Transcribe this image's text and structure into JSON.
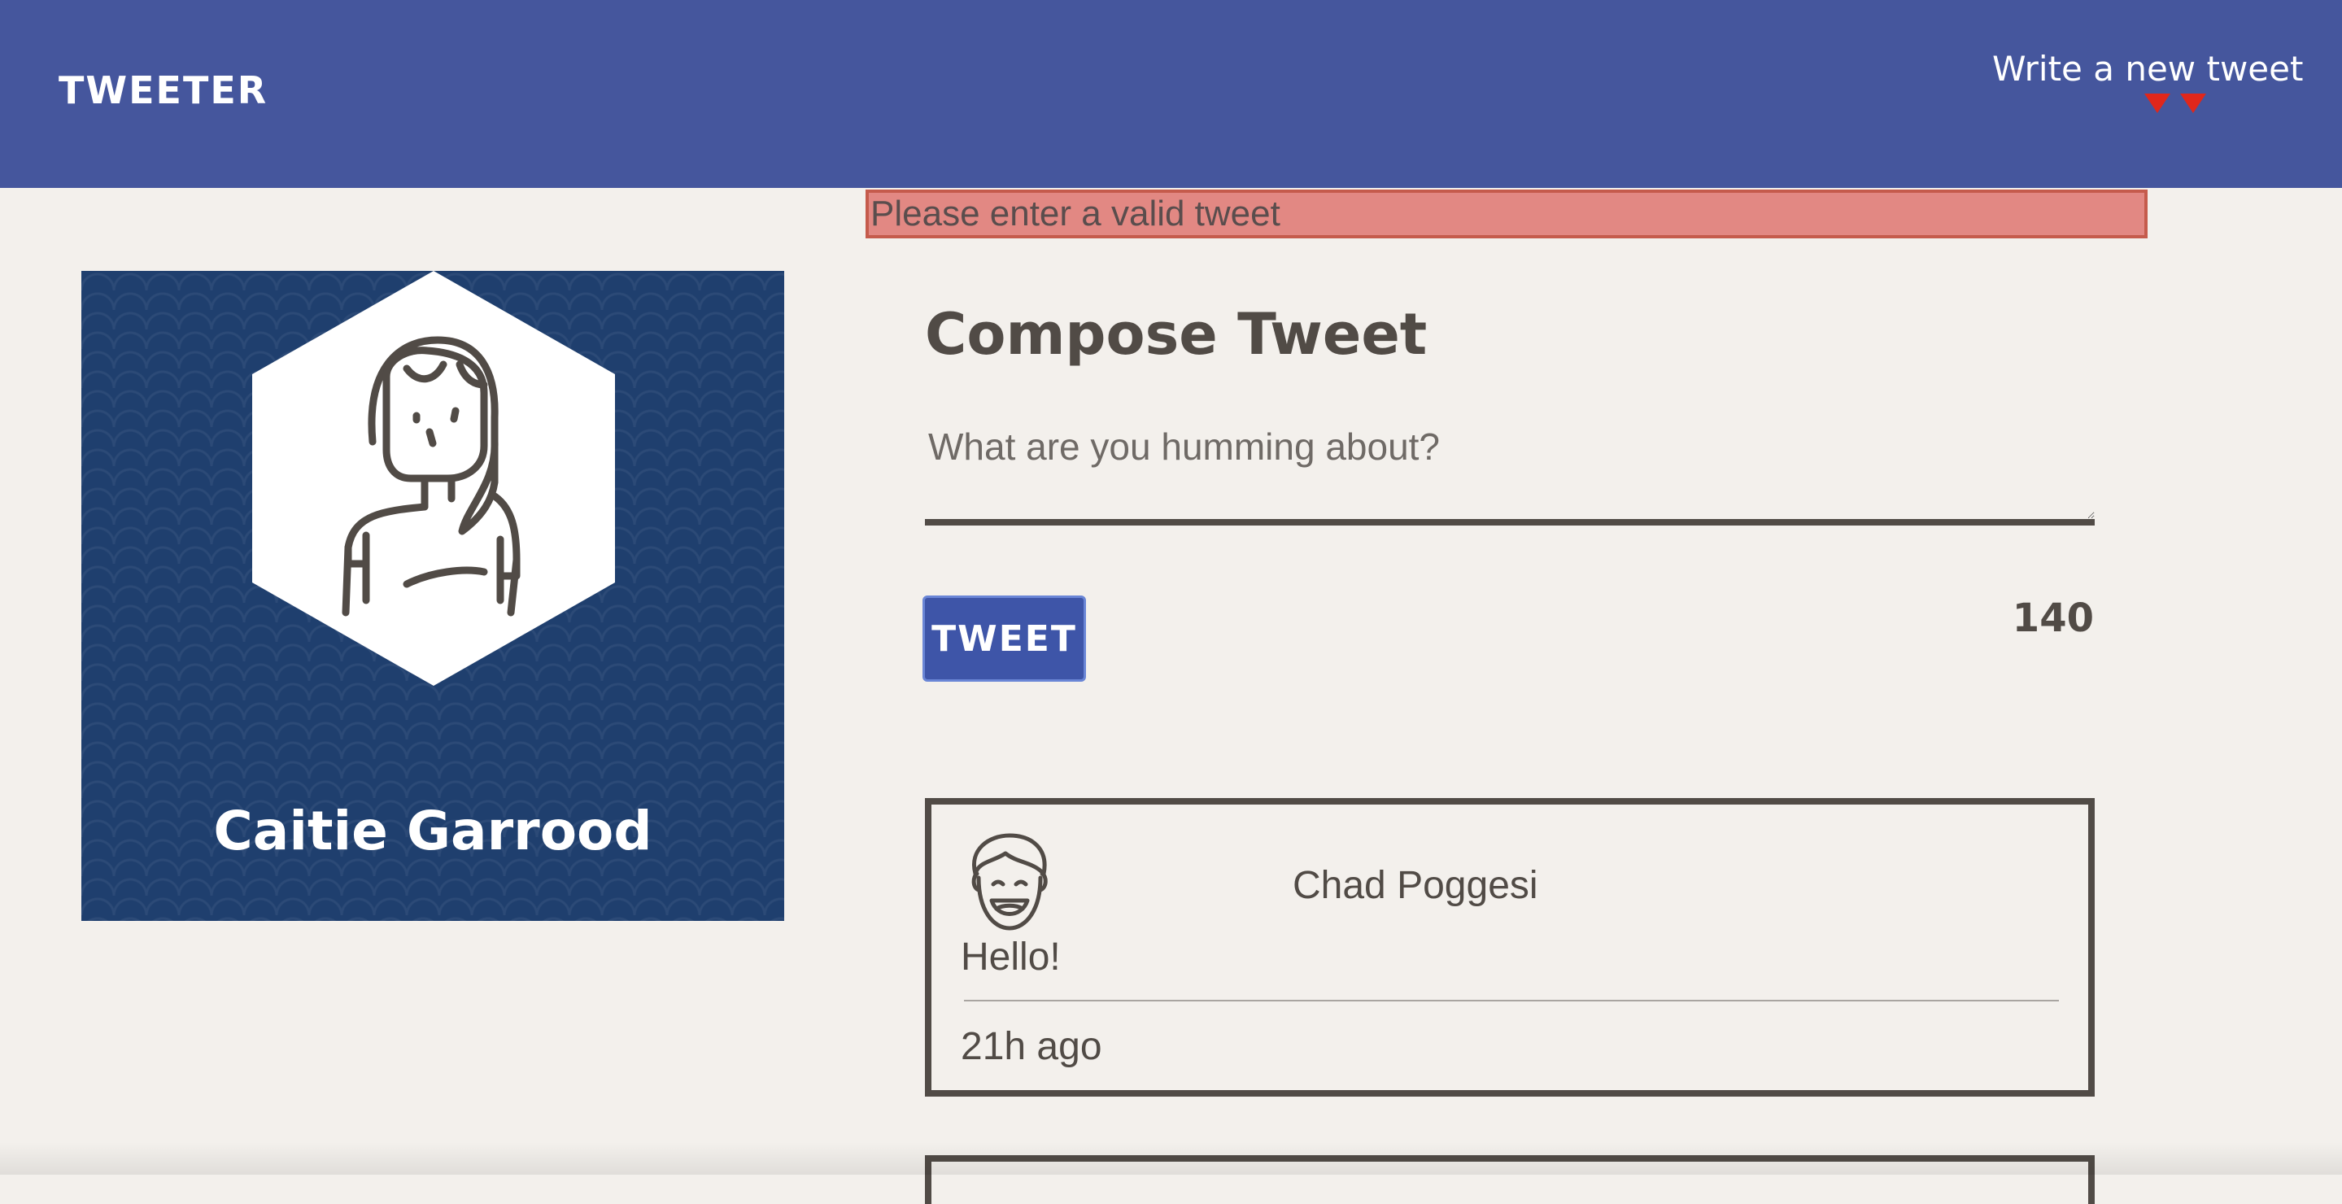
{
  "nav": {
    "brand": "TWEETER",
    "write_label": "Write a new tweet"
  },
  "error": {
    "message": "Please enter a valid tweet"
  },
  "profile": {
    "name": "Caitie Garrood"
  },
  "compose": {
    "title": "Compose Tweet",
    "placeholder": "What are you humming about?",
    "button_label": "TWEET",
    "counter": "140"
  },
  "tweets": [
    {
      "author": "Chad Poggesi",
      "text": "Hello!",
      "time": "21h ago"
    }
  ],
  "colors": {
    "nav_bg": "#45569d",
    "page_bg": "#f3f0ec",
    "error_bg": "#e28883",
    "profile_bg": "#1f3f6e",
    "button_bg": "#3e55a8",
    "text": "#514b46"
  }
}
